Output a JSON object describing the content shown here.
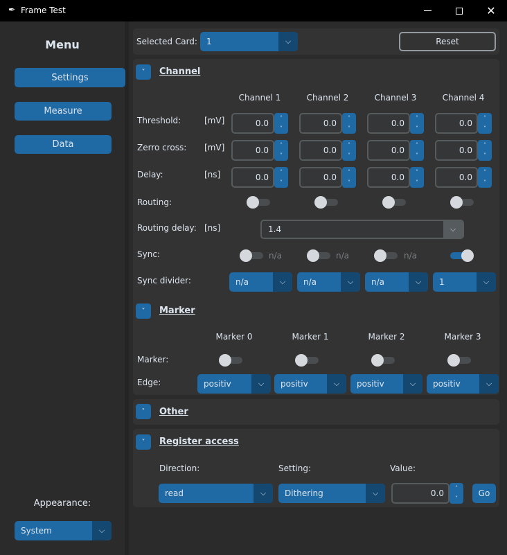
{
  "window": {
    "title": "Frame Test"
  },
  "sidebar": {
    "menu_title": "Menu",
    "buttons": [
      "Settings",
      "Measure",
      "Data"
    ],
    "appearance_label": "Appearance:",
    "appearance_value": "System"
  },
  "top": {
    "selected_card_label": "Selected Card:",
    "selected_card_value": "1",
    "reset_label": "Reset"
  },
  "channel": {
    "title": "Channel",
    "columns": [
      "Channel 1",
      "Channel 2",
      "Channel 3",
      "Channel 4"
    ],
    "threshold_label": "Threshold:",
    "threshold_unit": "[mV]",
    "threshold_values": [
      "0.0",
      "0.0",
      "0.0",
      "0.0"
    ],
    "zero_label": "Zerro cross:",
    "zero_unit": "[mV]",
    "zero_values": [
      "0.0",
      "0.0",
      "0.0",
      "0.0"
    ],
    "delay_label": "Delay:",
    "delay_unit": "[ns]",
    "delay_values": [
      "0.0",
      "0.0",
      "0.0",
      "0.0"
    ],
    "routing_label": "Routing:",
    "routing_states": [
      false,
      false,
      false,
      false
    ],
    "routing_delay_label": "Routing delay:",
    "routing_delay_unit": "[ns]",
    "routing_delay_value": "1.4",
    "sync_label": "Sync:",
    "sync_states": [
      false,
      false,
      false,
      true
    ],
    "sync_na": [
      "n/a",
      "n/a",
      "n/a",
      ""
    ],
    "sync_divider_label": "Sync divider:",
    "sync_divider_values": [
      "n/a",
      "n/a",
      "n/a",
      "1"
    ]
  },
  "marker": {
    "title": "Marker",
    "columns": [
      "Marker 0",
      "Marker 1",
      "Marker 2",
      "Marker 3"
    ],
    "marker_label": "Marker:",
    "marker_states": [
      false,
      false,
      false,
      false
    ],
    "edge_label": "Edge:",
    "edge_values": [
      "positiv",
      "positiv",
      "positiv",
      "positiv"
    ]
  },
  "other": {
    "title": "Other"
  },
  "register": {
    "title": "Register access",
    "direction_label": "Direction:",
    "direction_value": "read",
    "setting_label": "Setting:",
    "setting_value": "Dithering",
    "value_label": "Value:",
    "value": "0.0",
    "go_label": "Go"
  },
  "colors": {
    "accent": "#1f6aa5",
    "accent_dark": "#144870",
    "panel": "#333333",
    "background": "#2b2b2b"
  }
}
